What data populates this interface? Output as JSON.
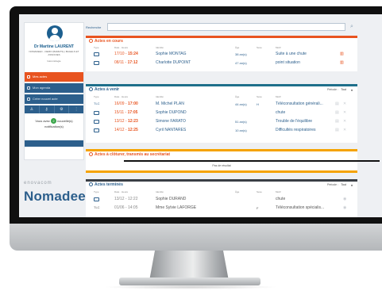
{
  "colors": {
    "orange": "#e8531f",
    "blue": "#2c5f8c",
    "teal": "#1f6f8b",
    "amber": "#f5a300",
    "dark": "#3a3f45"
  },
  "search": {
    "label": "Recherche",
    "value": "",
    "icon": "search-icon"
  },
  "profile": {
    "name": "Dr Martine LAURENT",
    "org": "NOMADEEC - DEMO (BARETS) | BAGELS ET ASSOCIES",
    "specialty": "Gérontologie",
    "menu": [
      {
        "label": "Mes actes",
        "icon": "stethoscope-icon",
        "active": true
      },
      {
        "label": "Mon agenda",
        "icon": "calendar-icon",
        "active": false
      },
      {
        "label": "Créer nouvel acte",
        "icon": "plus-icon",
        "active": false
      }
    ],
    "icon_toolbar": [
      "user-icon",
      "key-icon",
      "settings-icon",
      "more-icon"
    ],
    "notification": {
      "prefix": "Vous avez",
      "count": "2",
      "suffix": "nouvelle(s) notification(s)"
    }
  },
  "brand": {
    "company": "enovacom",
    "product": "Nomadeec"
  },
  "columns": {
    "type": "Type",
    "date": "Date · Heure",
    "identity": "Identité",
    "age": "Âge",
    "sex": "Sexe",
    "motif": "Motif"
  },
  "sections": {
    "en_cours": {
      "title": "Actes en cours",
      "rows": [
        {
          "type": "chat",
          "date": "17/10",
          "time": "15:24",
          "name": "Sophie MONTAG",
          "age": "38 an(s)",
          "sex": "",
          "motif": "Suite à une chute"
        },
        {
          "type": "chat",
          "date": "08/11",
          "time": "17:12",
          "name": "Charlotte DUPOINT",
          "age": "47 an(s)",
          "sex": "",
          "motif": "point situation"
        }
      ]
    },
    "a_venir": {
      "title": "Actes à venir",
      "filter_label": "Période :",
      "filter_value": "Tout",
      "rows": [
        {
          "type": "TLC",
          "date": "16/09",
          "time": "17:00",
          "name": "M. Michel PLAN",
          "age": "44 an(s)",
          "sex": "H",
          "motif": "Téléconsultation générali..."
        },
        {
          "type": "chat",
          "date": "15/11",
          "time": "17:05",
          "name": "Sophie DUPOND",
          "age": "",
          "sex": "",
          "motif": "chute"
        },
        {
          "type": "chat",
          "date": "13/12",
          "time": "12:23",
          "name": "Simone FARATO",
          "age": "51 an(s)",
          "sex": "",
          "motif": "Trouble de l'équilibre"
        },
        {
          "type": "chat",
          "date": "14/12",
          "time": "12:25",
          "name": "Cyril NANTARES",
          "age": "10 an(s)",
          "sex": "",
          "motif": "Difficultés respiratoires"
        }
      ]
    },
    "a_cloturer": {
      "title": "Actes à clôturer, transmis au secrétariat",
      "empty": "Pas de résultat"
    },
    "termines": {
      "title": "Actes terminés",
      "filter_label": "Période :",
      "filter_value": "Tout",
      "rows": [
        {
          "type": "chat",
          "date": "13/12",
          "time": "12:22",
          "name": "Sophie DURAND",
          "age": "",
          "sex": "",
          "motif": "chute"
        },
        {
          "type": "TLC",
          "date": "01/06",
          "time": "14:05",
          "name": "Mme Sylvie LAFORGE",
          "age": "",
          "sex": "F",
          "motif": "Téléconsultation spécialis..."
        }
      ]
    }
  }
}
